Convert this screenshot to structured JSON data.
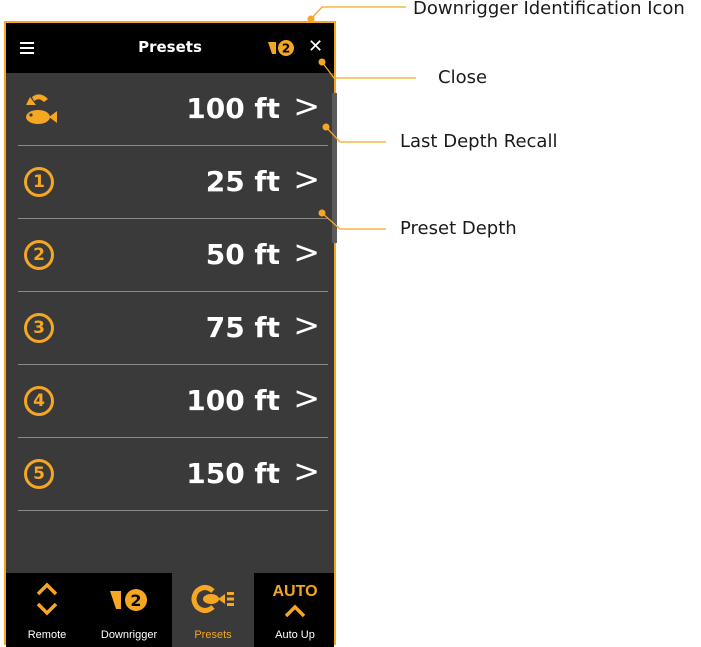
{
  "header": {
    "title": "Presets",
    "downrigger_badge_number": "2"
  },
  "rows": [
    {
      "icon": "last-depth-recall-icon",
      "value": "100 ft",
      "chevron": ">"
    },
    {
      "icon": "preset-1-icon",
      "number": "1",
      "value": "25 ft",
      "chevron": ">"
    },
    {
      "icon": "preset-2-icon",
      "number": "2",
      "value": "50 ft",
      "chevron": ">"
    },
    {
      "icon": "preset-3-icon",
      "number": "3",
      "value": "75 ft",
      "chevron": ">"
    },
    {
      "icon": "preset-4-icon",
      "number": "4",
      "value": "100 ft",
      "chevron": ">"
    },
    {
      "icon": "preset-5-icon",
      "number": "5",
      "value": "150 ft",
      "chevron": ">"
    }
  ],
  "tabs": [
    {
      "label": "Remote",
      "icon": "up-down-chevron-icon"
    },
    {
      "label": "Downrigger",
      "icon": "downrigger-icon",
      "badge": "2"
    },
    {
      "label": "Presets",
      "icon": "presets-icon",
      "active": true
    },
    {
      "label": "Auto Up",
      "icon": "auto-up-icon",
      "top_text": "AUTO"
    }
  ],
  "callouts": [
    {
      "text": "Downrigger Identification Icon"
    },
    {
      "text": "Close"
    },
    {
      "text": "Last Depth Recall"
    },
    {
      "text": "Preset Depth"
    }
  ],
  "colors": {
    "accent": "#f5a623",
    "panel": "#3a3a3a",
    "bar": "#000000",
    "text": "#ffffff"
  }
}
